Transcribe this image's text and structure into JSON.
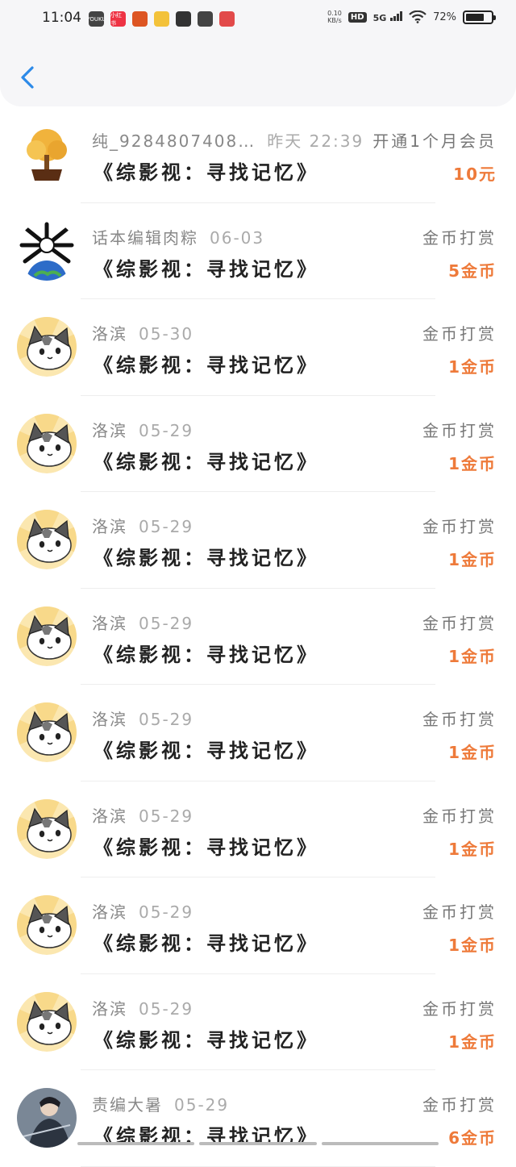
{
  "status_bar": {
    "time": "11:04",
    "notifications": [
      {
        "name": "youku-icon",
        "label": "YOUKU",
        "color": "#444444"
      },
      {
        "name": "xiaohongshu-icon",
        "label": "小红书",
        "color": "#ee3344"
      },
      {
        "name": "game-app-icon",
        "label": "",
        "color": "#dd5522"
      },
      {
        "name": "emoji-app-icon",
        "label": "",
        "color": "#f3c23a"
      },
      {
        "name": "swirl-app-icon",
        "label": "",
        "color": "#333333"
      },
      {
        "name": "wechat-icon",
        "label": "",
        "color": "#444444"
      },
      {
        "name": "monkey-app-icon",
        "label": "",
        "color": "#e24a4a"
      }
    ],
    "net_speed_value": "0.10",
    "net_speed_unit": "KB/s",
    "hd_label": "HD",
    "network_label": "5G",
    "battery_text": "72%",
    "battery_level": 0.72
  },
  "nav": {
    "back_icon": "chevron-left-icon",
    "accent_color": "#2c8ae8"
  },
  "records": [
    {
      "avatar": "money-tree",
      "user": "纯_9284807408…",
      "date": "昨天 22:39",
      "type": "开通1个月会员",
      "book": "《综影视：寻找记忆》",
      "amount": "10元"
    },
    {
      "avatar": "earth-bones",
      "user": "话本编辑肉粽",
      "date": "06-03",
      "type": "金币打赏",
      "book": "《综影视：寻找记忆》",
      "amount": "5金币"
    },
    {
      "avatar": "cat",
      "user": "洛滨",
      "date": "05-30",
      "type": "金币打赏",
      "book": "《综影视：寻找记忆》",
      "amount": "1金币"
    },
    {
      "avatar": "cat",
      "user": "洛滨",
      "date": "05-29",
      "type": "金币打赏",
      "book": "《综影视：寻找记忆》",
      "amount": "1金币"
    },
    {
      "avatar": "cat",
      "user": "洛滨",
      "date": "05-29",
      "type": "金币打赏",
      "book": "《综影视：寻找记忆》",
      "amount": "1金币"
    },
    {
      "avatar": "cat",
      "user": "洛滨",
      "date": "05-29",
      "type": "金币打赏",
      "book": "《综影视：寻找记忆》",
      "amount": "1金币"
    },
    {
      "avatar": "cat",
      "user": "洛滨",
      "date": "05-29",
      "type": "金币打赏",
      "book": "《综影视：寻找记忆》",
      "amount": "1金币"
    },
    {
      "avatar": "cat",
      "user": "洛滨",
      "date": "05-29",
      "type": "金币打赏",
      "book": "《综影视：寻找记忆》",
      "amount": "1金币"
    },
    {
      "avatar": "cat",
      "user": "洛滨",
      "date": "05-29",
      "type": "金币打赏",
      "book": "《综影视：寻找记忆》",
      "amount": "1金币"
    },
    {
      "avatar": "cat",
      "user": "洛滨",
      "date": "05-29",
      "type": "金币打赏",
      "book": "《综影视：寻找记忆》",
      "amount": "1金币"
    },
    {
      "avatar": "warrior",
      "user": "责编大暑",
      "date": "05-29",
      "type": "金币打赏",
      "book": "《综影视：寻找记忆》",
      "amount": "6金币"
    }
  ],
  "colors": {
    "amount": "#ee7a3a",
    "header_bg": "#f6f6f8"
  }
}
